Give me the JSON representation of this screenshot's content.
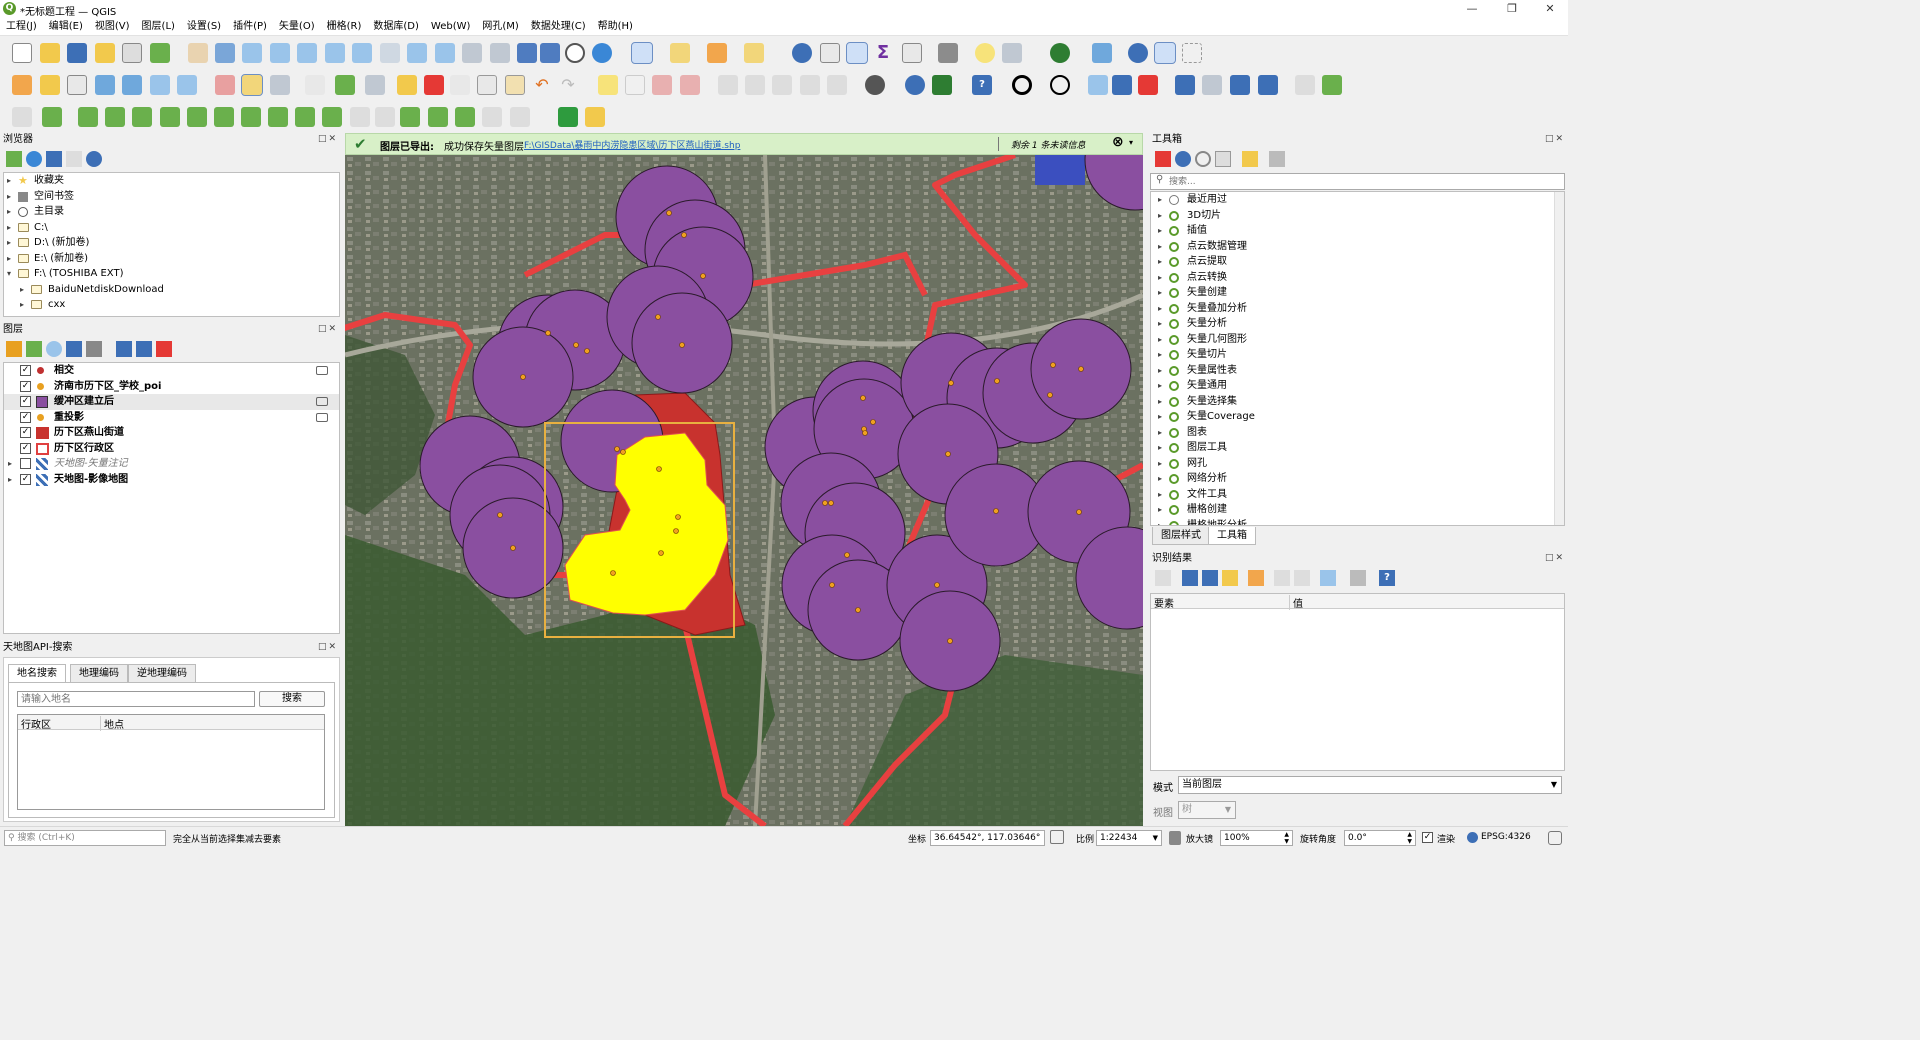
{
  "window": {
    "title": "*无标题工程 — QGIS"
  },
  "menu": [
    "工程(J)",
    "编辑(E)",
    "视图(V)",
    "图层(L)",
    "设置(S)",
    "插件(P)",
    "矢量(O)",
    "栅格(R)",
    "数据库(D)",
    "Web(W)",
    "网孔(M)",
    "数据处理(C)",
    "帮助(H)"
  ],
  "browser": {
    "title": "浏览器",
    "items": [
      "收藏夹",
      "空间书签",
      "主目录",
      "C:\\",
      "D:\\ (新加卷)",
      "E:\\ (新加卷)",
      "F:\\ (TOSHIBA EXT)",
      "BaiduNetdiskDownload",
      "cxx"
    ]
  },
  "layers": {
    "title": "图层",
    "items": [
      {
        "name": "相交",
        "checked": true,
        "color": "#c03030"
      },
      {
        "name": "济南市历下区_学校_poi",
        "checked": true,
        "color": "#e8a020"
      },
      {
        "name": "缓冲区建立后",
        "checked": true,
        "color": "#8a4fa0"
      },
      {
        "name": "重投影",
        "checked": true,
        "color": "#e8a020"
      },
      {
        "name": "历下区燕山街道",
        "checked": true,
        "color": "#c8322e"
      },
      {
        "name": "历下区行政区",
        "checked": true,
        "color": "#e04040"
      },
      {
        "name": "天地图-矢量注记",
        "checked": false
      },
      {
        "name": "天地图-影像地图",
        "checked": true
      }
    ]
  },
  "tianditu": {
    "title": "天地图API-搜索",
    "tabs": [
      "地名搜索",
      "地理编码",
      "逆地理编码"
    ],
    "search_placeholder": "请输入地名",
    "search_button": "搜索",
    "columns": [
      "行政区",
      "地点"
    ]
  },
  "message": {
    "title": "图层已导出:",
    "text": "成功保存矢量图层",
    "link": "F:\\GISData\\暴雨中内涝隐患区域\\历下区燕山街道.shp",
    "remaining": "剩余 1 条未读信息"
  },
  "toolbox": {
    "title": "工具箱",
    "search_placeholder": "搜索...",
    "items": [
      "最近用过",
      "3D切片",
      "插值",
      "点云数据管理",
      "点云提取",
      "点云转换",
      "矢量创建",
      "矢量叠加分析",
      "矢量分析",
      "矢量几何图形",
      "矢量切片",
      "矢量属性表",
      "矢量通用",
      "矢量选择集",
      "矢量Coverage",
      "图表",
      "图层工具",
      "网孔",
      "网络分析",
      "文件工具",
      "栅格创建",
      "栅格地形分析"
    ],
    "tabs": [
      "图层样式",
      "工具箱"
    ]
  },
  "identify": {
    "title": "识别结果",
    "columns": [
      "要素",
      "值"
    ],
    "mode_label": "模式",
    "mode_value": "当前图层",
    "view_label": "视图",
    "view_value": "树"
  },
  "status": {
    "search_placeholder": "搜索 (Ctrl+K)",
    "hint": "完全从当前选择集减去要素",
    "coord_label": "坐标",
    "coord_value": "36.64542°, 117.03646°",
    "scale_label": "比例",
    "scale_value": "1:22434",
    "magnifier_label": "放大镜",
    "magnifier_value": "100%",
    "rotation_label": "旋转角度",
    "rotation_value": "0.0°",
    "render_label": "渲染",
    "crs": "EPSG:4326"
  },
  "map_legend_colors": {
    "buffer": "#8a4fa0",
    "poi": "#f0a020",
    "boundary": "#e84040",
    "intersect": "#ffff00",
    "street": "#c8322e",
    "selection_rect": "#e8b040"
  }
}
